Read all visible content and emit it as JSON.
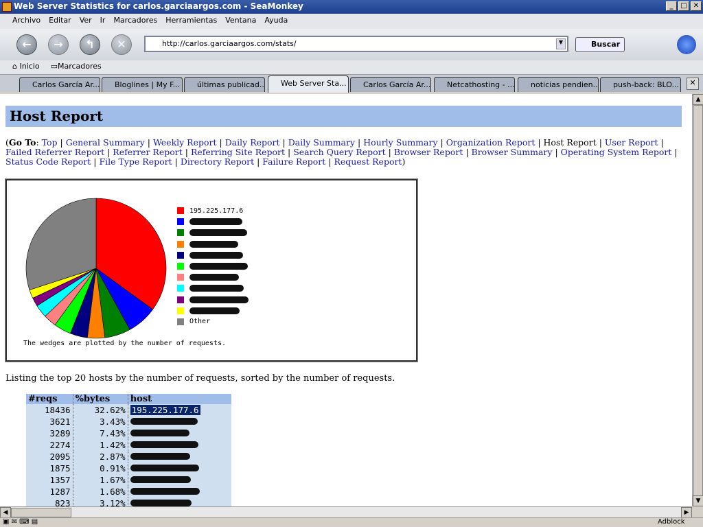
{
  "window": {
    "title": "Web Server Statistics for carlos.garciaargos.com - SeaMonkey"
  },
  "menu": [
    "Archivo",
    "Editar",
    "Ver",
    "Ir",
    "Marcadores",
    "Herramientas",
    "Ventana",
    "Ayuda"
  ],
  "nav": {
    "url": "http://carlos.garciaargos.com/stats/",
    "search_label": "Buscar"
  },
  "bookmarks": [
    "Inicio",
    "Marcadores"
  ],
  "tabs": [
    "Carlos García Ar...",
    "Bloglines | My F...",
    "últimas publicad...",
    "Web Server Sta...",
    "Carlos García Ar...",
    "Netcathosting - ...",
    "noticias pendien...",
    "push-back: BLO..."
  ],
  "page": {
    "title": "Host Report",
    "goto_label": "Go To",
    "links": [
      "Top",
      "General Summary",
      "Weekly Report",
      "Daily Report",
      "Daily Summary",
      "Hourly Summary",
      "Organization Report",
      "Host Report",
      "User Report",
      "Failed Referrer Report",
      "Referrer Report",
      "Referring Site Report",
      "Search Query Report",
      "Browser Report",
      "Browser Summary",
      "Operating System Report",
      "Status Code Report",
      "File Type Report",
      "Directory Report",
      "Failure Report",
      "Request Report"
    ],
    "current": "Host Report",
    "chart_note": "The wedges are plotted by the number of requests.",
    "listing": "Listing the top 20 hosts by the number of requests, sorted by the number of requests."
  },
  "chart_data": {
    "type": "pie",
    "legend": [
      "195.225.177.6",
      "",
      "",
      "",
      "",
      "",
      "",
      "",
      "",
      "",
      "Other"
    ],
    "values": [
      35,
      7,
      6,
      4,
      4,
      4,
      3,
      3,
      2,
      2,
      30
    ],
    "colors": [
      "#ff0000",
      "#0000ff",
      "#008000",
      "#ff8000",
      "#000080",
      "#00ff00",
      "#ff8080",
      "#00ffff",
      "#800080",
      "#ffff00",
      "#808080"
    ]
  },
  "table": {
    "headers": [
      "#reqs",
      "%bytes",
      "host"
    ],
    "rows": [
      [
        "18436",
        "32.62%",
        "195.225.177.6"
      ],
      [
        "3621",
        "3.43%",
        ""
      ],
      [
        "3289",
        "7.43%",
        ""
      ],
      [
        "2274",
        "1.42%",
        ""
      ],
      [
        "2095",
        "2.87%",
        ""
      ],
      [
        "1875",
        "0.91%",
        ""
      ],
      [
        "1357",
        "1.67%",
        ""
      ],
      [
        "1287",
        "1.68%",
        ""
      ],
      [
        "823",
        "3.12%",
        ""
      ]
    ]
  },
  "status": {
    "adblock": "Adblock"
  }
}
